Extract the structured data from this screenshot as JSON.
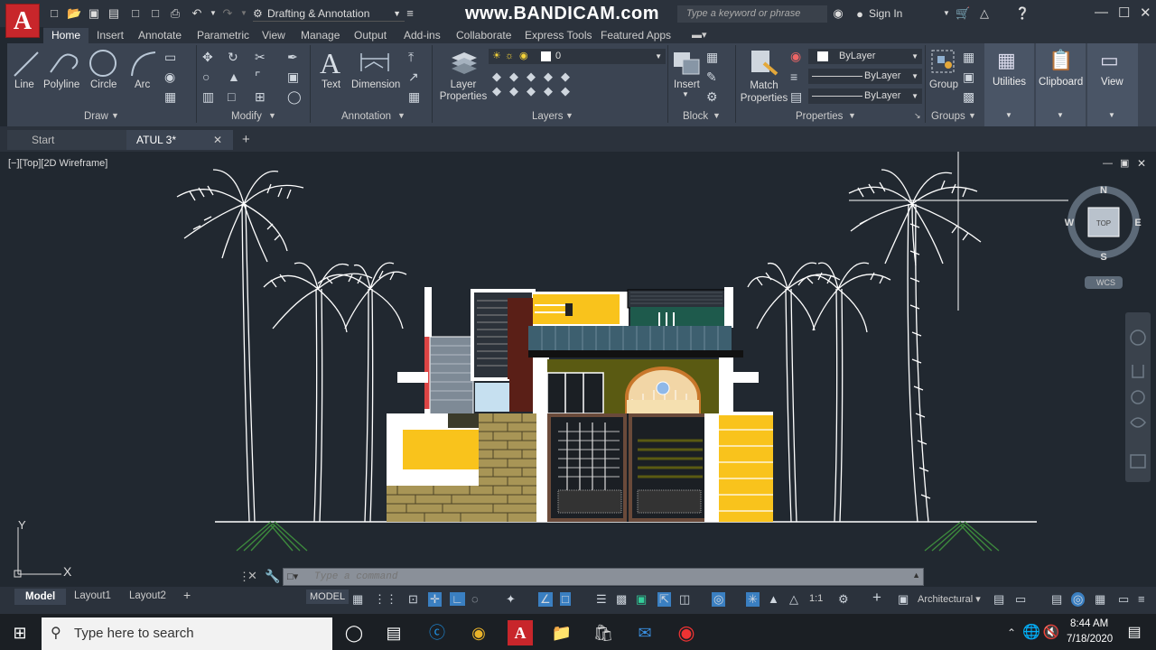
{
  "app": {
    "logo_letter": "A",
    "watermark": "www.BANDICAM.com"
  },
  "titlebar": {
    "workspace": "Drafting & Annotation",
    "search_placeholder": "Type a keyword or phrase",
    "sign_in": "Sign In"
  },
  "ribbon_tabs": [
    "Home",
    "Insert",
    "Annotate",
    "Parametric",
    "View",
    "Manage",
    "Output",
    "Add-ins",
    "Collaborate",
    "Express Tools",
    "Featured Apps"
  ],
  "draw": {
    "label": "Draw",
    "line": "Line",
    "polyline": "Polyline",
    "circle": "Circle",
    "arc": "Arc"
  },
  "modify": {
    "label": "Modify"
  },
  "annotation": {
    "label": "Annotation",
    "text": "Text",
    "dimension": "Dimension"
  },
  "layers": {
    "label": "Layers",
    "layer_properties": "Layer Properties",
    "current_layer": "0"
  },
  "block": {
    "label": "Block",
    "insert": "Insert"
  },
  "properties": {
    "label": "Properties",
    "match": "Match Properties",
    "color": "ByLayer",
    "linetype": "ByLayer",
    "lineweight": "ByLayer"
  },
  "groups": {
    "label": "Groups",
    "group": "Group"
  },
  "utilities": "Utilities",
  "clipboard": "Clipboard",
  "view_panel": "View",
  "doc_tabs": {
    "start": "Start",
    "current": "ATUL 3*"
  },
  "viewport": {
    "label": "[−][Top][2D Wireframe]",
    "compass": {
      "n": "N",
      "s": "S",
      "e": "E",
      "w": "W",
      "top": "TOP",
      "wcs": "WCS"
    },
    "ucs_x": "X",
    "ucs_y": "Y"
  },
  "command": {
    "placeholder": "Type a command"
  },
  "layout_tabs": {
    "model": "Model",
    "layout1": "Layout1",
    "layout2": "Layout2"
  },
  "status": {
    "model": "MODEL",
    "scale": "1:1",
    "units": "Architectural"
  },
  "taskbar": {
    "search_placeholder": "Type here to search",
    "time": "8:44 AM",
    "date": "7/18/2020"
  },
  "colors": {
    "yellow": "#f9c31c",
    "brick": "#a89556",
    "olive": "#5a5a12",
    "navy_bg": "#212830"
  }
}
